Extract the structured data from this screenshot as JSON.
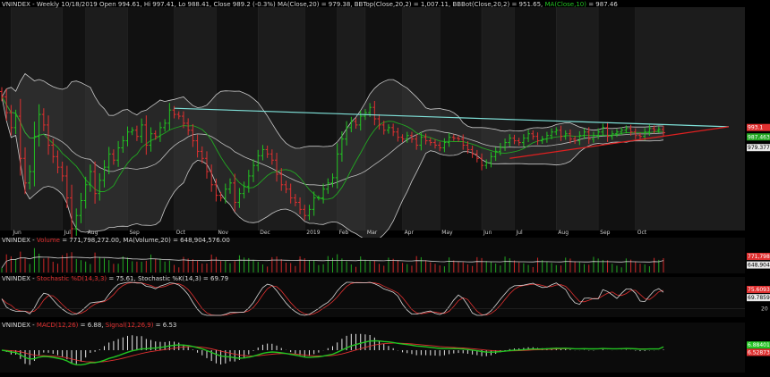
{
  "header": {
    "price": [
      {
        "text": "VNINDEX - Weekly 10/18/2019 Open 994.61, Hi 997.41, Lo 988.41, Close 989.2 (-0.3%) MA(Close,20) = 979.38, BBTop(Close,20,2) = 1,007.11, BBBot(Close,20,2) = 951.65, ",
        "color": "#dcdcdc"
      },
      {
        "text": "MA(Close,10)",
        "color": "#22c422"
      },
      {
        "text": " = 987.46",
        "color": "#dcdcdc"
      }
    ],
    "volume": [
      {
        "text": "VNINDEX - ",
        "color": "#dcdcdc"
      },
      {
        "text": "Volume",
        "color": "#e03030"
      },
      {
        "text": " = 771,798,272.00, MA(Volume,20) = 648,904,576.00",
        "color": "#dcdcdc"
      }
    ],
    "stoch": [
      {
        "text": "VNINDEX - ",
        "color": "#dcdcdc"
      },
      {
        "text": "Stochastic %D(14,3,3)",
        "color": "#e03030"
      },
      {
        "text": " = 75.61, Stochastic %K(14,3) = 69.79",
        "color": "#dcdcdc"
      }
    ],
    "macd": [
      {
        "text": "VNINDEX - ",
        "color": "#dcdcdc"
      },
      {
        "text": "MACD(12,26)",
        "color": "#e03030"
      },
      {
        "text": " = 6.88, ",
        "color": "#dcdcdc"
      },
      {
        "text": "Signal(12,26,9)",
        "color": "#e03030"
      },
      {
        "text": " = 6.53",
        "color": "#dcdcdc"
      }
    ]
  },
  "chart_data": {
    "type": "ohlc",
    "x_labels": [
      "Jun",
      "Jul",
      "Aug",
      "Sep",
      "Oct",
      "Nov",
      "Dec",
      "2019",
      "Feb",
      "Mar",
      "Apr",
      "May",
      "Jun",
      "Jul",
      "Aug",
      "Sep",
      "Oct"
    ],
    "x_label_weeks": [
      2,
      13,
      18,
      27,
      37,
      46,
      55,
      65,
      72,
      78,
      86,
      94,
      103,
      110,
      119,
      128,
      136
    ],
    "price_ylim": [
      880,
      1130
    ],
    "closes": [
      1030,
      1012,
      995,
      1008,
      960,
      932,
      945,
      985,
      1010,
      998,
      975,
      962,
      950,
      940,
      915,
      880,
      895,
      912,
      930,
      945,
      920,
      935,
      950,
      965,
      958,
      972,
      980,
      990,
      992,
      985,
      998,
      975,
      988,
      985,
      995,
      1000,
      1015,
      1010,
      1008,
      1000,
      992,
      980,
      968,
      960,
      945,
      930,
      918,
      915,
      925,
      932,
      910,
      920,
      928,
      940,
      952,
      963,
      970,
      965,
      958,
      942,
      930,
      925,
      915,
      910,
      902,
      895,
      902,
      915,
      915,
      925,
      932,
      938,
      965,
      982,
      995,
      1002,
      998,
      1008,
      1012,
      1018,
      1005,
      998,
      992,
      995,
      990,
      984,
      982,
      986,
      982,
      975,
      984,
      980,
      978,
      975,
      972,
      978,
      984,
      983,
      982,
      975,
      970,
      965,
      960,
      952,
      955,
      962,
      968,
      973,
      978,
      983,
      980,
      978,
      983,
      988,
      985,
      980,
      982,
      986,
      990,
      992,
      985,
      988,
      982,
      980,
      986,
      990,
      982,
      986,
      990,
      995,
      985,
      988,
      990,
      992,
      994,
      990,
      986,
      985,
      990,
      994,
      992,
      993,
      989.2
    ],
    "price_labels": [
      {
        "text": "993.1",
        "value": 993.1,
        "color": "#e03030"
      },
      {
        "text": "987.463",
        "value": 987.46,
        "color": "#22a822"
      },
      {
        "text": "979.377",
        "value": 979.38,
        "color": "#e8e8e8"
      }
    ],
    "trendlines": [
      {
        "name": "resistance",
        "color": "#7fe0d8",
        "from": {
          "week": 37,
          "value": 1017
        },
        "to": {
          "week": 156,
          "value": 996
        }
      },
      {
        "name": "support",
        "color": "#e02020",
        "from": {
          "week": 109,
          "value": 960
        },
        "to": {
          "week": 156,
          "value": 996
        }
      }
    ],
    "volume": {
      "ylim": [
        0,
        1500000000
      ],
      "last_volume": 771798272,
      "last_ma": 648904576,
      "labels": [
        {
          "text": "771,798,272",
          "value": 771798272,
          "color": "#e03030"
        },
        {
          "text": "648,904,5",
          "value": 648904576,
          "color": "#e8e8e8"
        }
      ]
    },
    "stochastic": {
      "ylim": [
        0,
        100
      ],
      "tick": "20",
      "d_last": 75.61,
      "k_last": 69.79,
      "labels": [
        {
          "text": "75.6093",
          "value": 75.61,
          "color": "#e03030"
        },
        {
          "text": "69.7859",
          "value": 69.79,
          "color": "#e8e8e8"
        }
      ]
    },
    "macd": {
      "ylim": [
        -40,
        40
      ],
      "macd_last": 6.88,
      "signal_last": 6.53,
      "labels": [
        {
          "text": "6.88401",
          "value": 6.88,
          "color": "#22c422"
        },
        {
          "text": "6.52873",
          "value": 6.53,
          "color": "#e03030"
        }
      ]
    }
  }
}
